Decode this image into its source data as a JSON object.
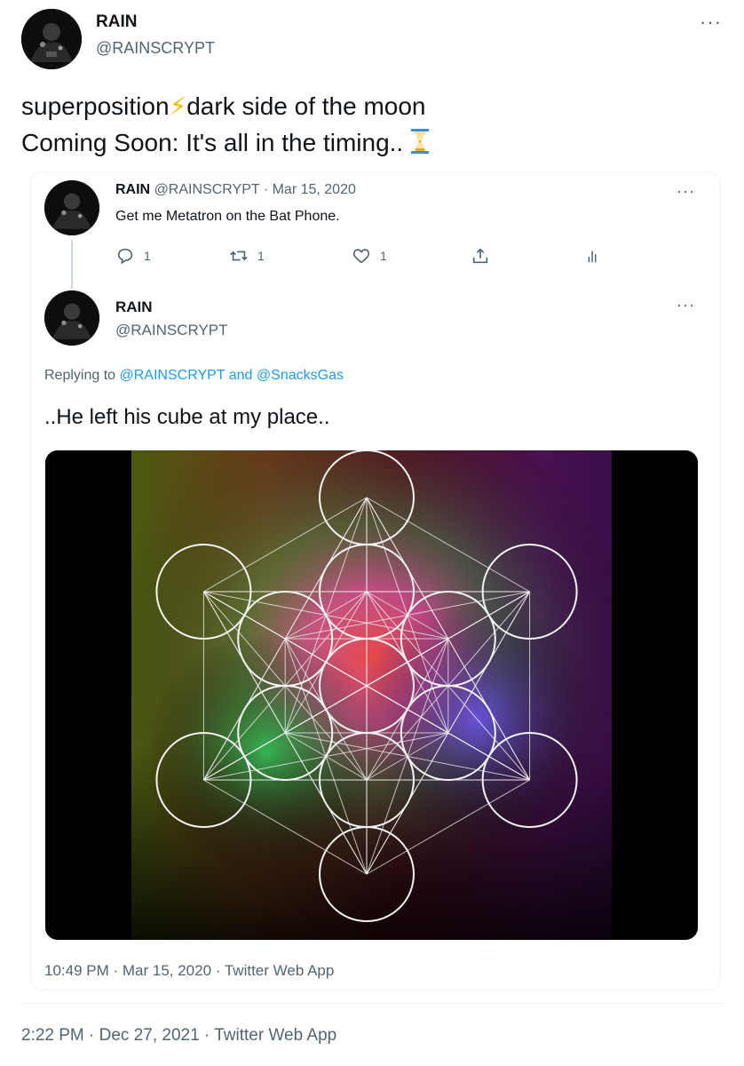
{
  "main_tweet": {
    "author_name": "RAIN",
    "author_handle": "@RAINSCRYPT",
    "line1_before": "superposition",
    "line1_emoji": "⚡",
    "line1_after": "dark side of the moon",
    "line2": "Coming Soon: It's all in the timing..",
    "line2_emoji": "⏳",
    "timestamp": "2:22 PM · Dec 27, 2021 · Twitter Web App"
  },
  "thread_parent": {
    "author_name": "RAIN",
    "author_handle": "@RAINSCRYPT",
    "date": "· Mar 15, 2020",
    "text": "Get me Metatron on the Bat Phone.",
    "reply_count": "1",
    "retweet_count": "1",
    "like_count": "1"
  },
  "quoted_tweet": {
    "author_name": "RAIN",
    "author_handle": "@RAINSCRYPT",
    "replying_prefix": "Replying to",
    "replying_to_1": "@RAINSCRYPT",
    "replying_and": "and",
    "replying_to_2": "@SnacksGas",
    "text": "..He left his cube at my place..",
    "timestamp": "10:49 PM · Mar 15, 2020 · Twitter Web App"
  },
  "menu_label": "···",
  "icons": {
    "more": "more-icon",
    "reply": "reply-icon",
    "retweet": "retweet-icon",
    "like": "like-icon",
    "share": "share-icon",
    "analytics": "analytics-icon"
  },
  "colors": {
    "link": "#1d9bf0",
    "muted": "#536471",
    "text": "#0f1419"
  }
}
